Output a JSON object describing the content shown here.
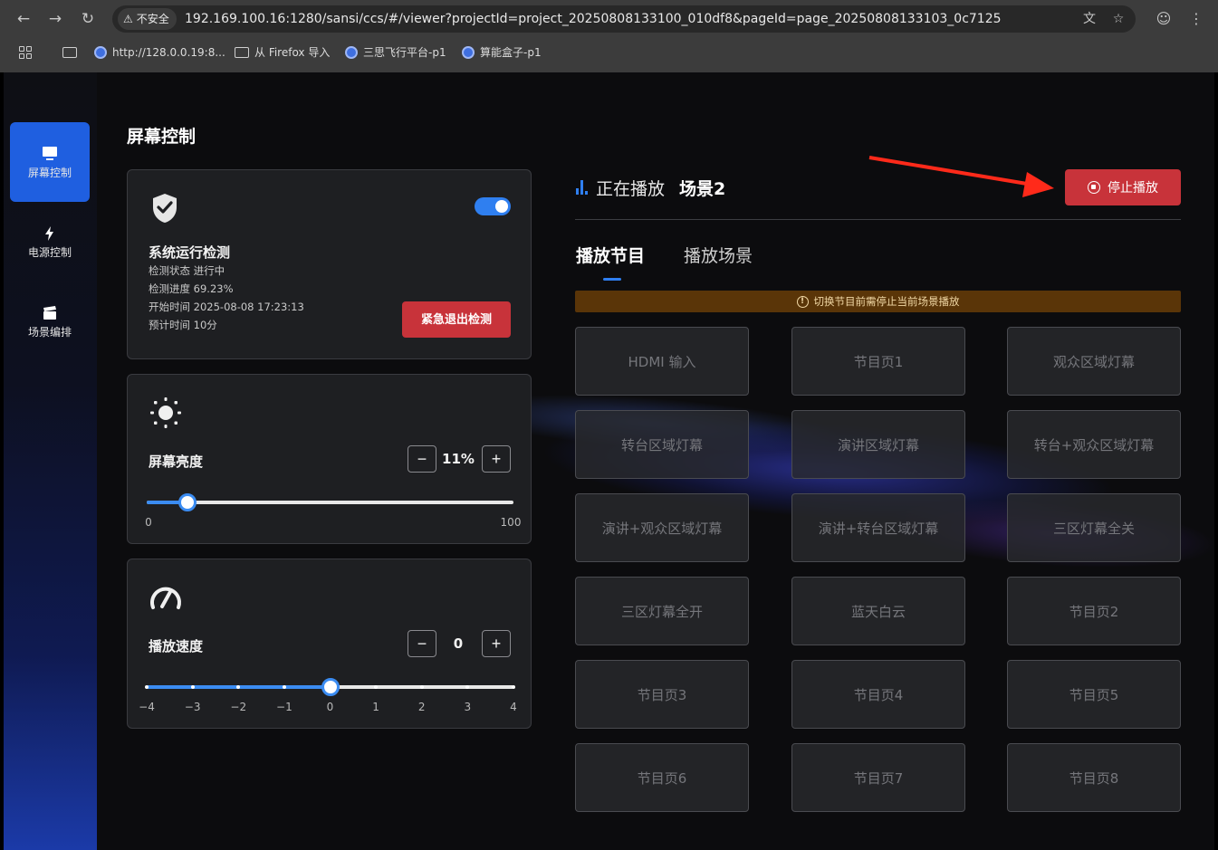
{
  "browser": {
    "security_label": "不安全",
    "url": "192.169.100.16:1280/sansi/ccs/#/viewer?projectId=project_20250808133100_010df8&pageId=page_20250808133103_0c7125",
    "bookmarks": [
      {
        "label": "http://128.0.0.19:8...",
        "icon": "globe-icon"
      },
      {
        "label": "从 Firefox 导入",
        "icon": "folder-icon"
      },
      {
        "label": "三思飞行平台-p1",
        "icon": "globe-icon"
      },
      {
        "label": "算能盒子-p1",
        "icon": "globe-icon"
      }
    ]
  },
  "sidebar": {
    "items": [
      {
        "label": "屏幕控制",
        "icon": "monitor-icon",
        "active": true
      },
      {
        "label": "电源控制",
        "icon": "bolt-icon",
        "active": false
      },
      {
        "label": "场景编排",
        "icon": "clapper-icon",
        "active": false
      }
    ]
  },
  "page": {
    "title": "屏幕控制"
  },
  "system_check": {
    "title": "系统运行检测",
    "status": "检测状态 进行中",
    "progress": "检测进度 69.23%",
    "start_time": "开始时间 2025-08-08 17:23:13",
    "estimated": "预计时间 10分",
    "toggle_on": true,
    "exit_button": "紧急退出检测"
  },
  "brightness": {
    "title": "屏幕亮度",
    "value_label": "11%",
    "value": 11,
    "min_label": "0",
    "max_label": "100",
    "minus": "−",
    "plus": "+"
  },
  "speed": {
    "title": "播放速度",
    "value_label": "0",
    "value": 0,
    "ticks": [
      "−4",
      "−3",
      "−2",
      "−1",
      "0",
      "1",
      "2",
      "3",
      "4"
    ],
    "minus": "−",
    "plus": "+"
  },
  "playback": {
    "status_label": "正在播放",
    "scene": "场景2",
    "stop_button": "停止播放",
    "accent_color": "#2f7ff0",
    "danger_color": "#c8333a"
  },
  "tabs": [
    {
      "label": "播放节目",
      "active": true
    },
    {
      "label": "播放场景",
      "active": false
    }
  ],
  "warning": "切换节目前需停止当前场景播放",
  "programs": [
    "HDMI 输入",
    "节目页1",
    "观众区域灯幕",
    "转台区域灯幕",
    "演讲区域灯幕",
    "转台+观众区域灯幕",
    "演讲+观众区域灯幕",
    "演讲+转台区域灯幕",
    "三区灯幕全关",
    "三区灯幕全开",
    "蓝天白云",
    "节目页2",
    "节目页3",
    "节目页4",
    "节目页5",
    "节目页6",
    "节目页7",
    "节目页8"
  ]
}
